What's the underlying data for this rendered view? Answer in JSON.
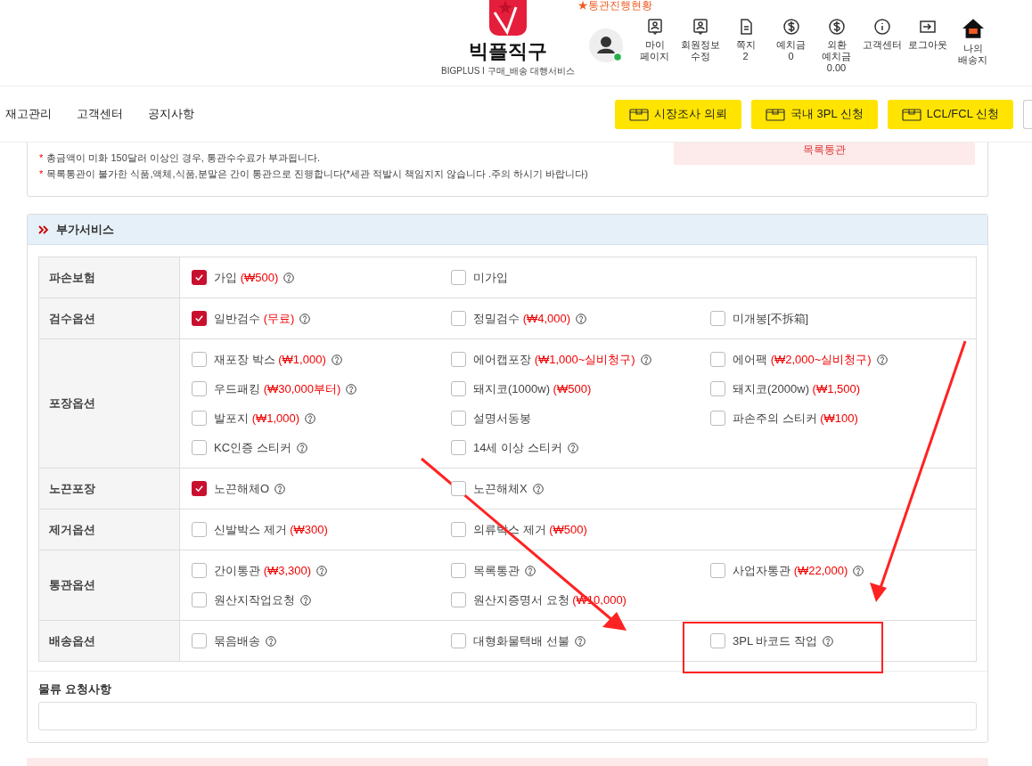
{
  "header": {
    "status_link": "★통관진행현황",
    "brand": "빅플직구",
    "tagline": "BIGPLUS I 구매_배송 대행서비스",
    "menu": [
      {
        "kind": "profile",
        "lines": [
          "마이",
          "페이지"
        ]
      },
      {
        "kind": "profile",
        "lines": [
          "회원정보",
          "수정"
        ]
      },
      {
        "kind": "document",
        "lines": [
          "쪽지",
          "2"
        ]
      },
      {
        "kind": "money",
        "lines": [
          "예치금",
          "0"
        ]
      },
      {
        "kind": "money",
        "lines": [
          "외환",
          "예치금",
          "0.00"
        ]
      },
      {
        "kind": "info",
        "lines": [
          "고객센터"
        ]
      },
      {
        "kind": "logout",
        "lines": [
          "로그아웃"
        ]
      },
      {
        "kind": "home",
        "lines": [
          "나의",
          "배송지"
        ]
      }
    ]
  },
  "nav": {
    "links": [
      "재고관리",
      "고객센터",
      "공지사항"
    ],
    "buttons": [
      "시장조사 의뢰",
      "국내 3PL 신청",
      "LCL/FCL 신청"
    ]
  },
  "notice": {
    "lines": [
      {
        "mark": "*",
        "text": "총금액이 미화 150달러 이상인 경우, 통관수수료가 부과됩니다."
      },
      {
        "mark": "*",
        "text": "목록통관이 불가한 식품,액체,식품,분말은 간이 통관으로 진행합니다(*세관 적발시 책임지지 않습니다 .주의 하시기 바랍니다)"
      }
    ],
    "status_box": "목록통관"
  },
  "section": {
    "title": "부가서비스",
    "rows": [
      {
        "label": "파손보험",
        "options": [
          {
            "text": "가입",
            "price": "(₩500)",
            "help": true,
            "checked": true
          },
          {
            "text": "미가입",
            "help": false,
            "checked": false
          }
        ]
      },
      {
        "label": "검수옵션",
        "options": [
          {
            "text": "일반검수",
            "price": "(무료)",
            "help": true,
            "checked": true
          },
          {
            "text": "정밀검수",
            "price": "(₩4,000)",
            "help": true,
            "checked": false
          },
          {
            "text": "미개봉[不拆箱]",
            "help": false,
            "checked": false
          }
        ]
      },
      {
        "label": "포장옵션",
        "options": [
          {
            "text": "재포장 박스",
            "price": "(₩1,000)",
            "help": true,
            "checked": false
          },
          {
            "text": "에어캡포장",
            "price": "(₩1,000~실비청구)",
            "help": true,
            "checked": false
          },
          {
            "text": "에어팩",
            "price": "(₩2,000~실비청구)",
            "help": true,
            "checked": false
          },
          {
            "text": "우드패킹",
            "price": "(₩30,000부터)",
            "help": true,
            "checked": false
          },
          {
            "text": "돼지코(1000w)",
            "price": "(₩500)",
            "help": false,
            "checked": false
          },
          {
            "text": "돼지코(2000w)",
            "price": "(₩1,500)",
            "help": false,
            "checked": false
          },
          {
            "text": "발포지",
            "price": "(₩1,000)",
            "help": true,
            "checked": false
          },
          {
            "text": "설명서동봉",
            "help": false,
            "checked": false
          },
          {
            "text": "파손주의 스티커",
            "price": "(₩100)",
            "help": false,
            "checked": false
          },
          {
            "text": "KC인증 스티커",
            "help": true,
            "checked": false
          },
          {
            "text": "14세 이상 스티커",
            "help": true,
            "checked": false
          }
        ]
      },
      {
        "label": "노끈포장",
        "options": [
          {
            "text": "노끈해체O",
            "help": true,
            "checked": true
          },
          {
            "text": "노끈해체X",
            "help": true,
            "checked": false
          }
        ]
      },
      {
        "label": "제거옵션",
        "options": [
          {
            "text": "신발박스 제거",
            "price": "(₩300)",
            "help": false,
            "checked": false
          },
          {
            "text": "의류박스 제거",
            "price": "(₩500)",
            "help": false,
            "checked": false
          }
        ]
      },
      {
        "label": "통관옵션",
        "options": [
          {
            "text": "간이통관",
            "price": "(₩3,300)",
            "help": true,
            "checked": false
          },
          {
            "text": "목록통관",
            "help": true,
            "checked": false
          },
          {
            "text": "사업자통관",
            "price": "(₩22,000)",
            "help": true,
            "checked": false
          },
          {
            "text": "원산지작업요청",
            "help": true,
            "checked": false
          },
          {
            "text": "원산지증명서 요청",
            "price": "(₩10,000)",
            "help": false,
            "checked": false
          }
        ]
      },
      {
        "label": "배송옵션",
        "options": [
          {
            "text": "묶음배송",
            "help": true,
            "checked": false
          },
          {
            "text": "대형화물택배 선불",
            "help": true,
            "checked": false
          },
          {
            "text": "3PL 바코드 작업",
            "help": true,
            "checked": false
          }
        ]
      }
    ],
    "request_label": "물류 요청사항"
  }
}
